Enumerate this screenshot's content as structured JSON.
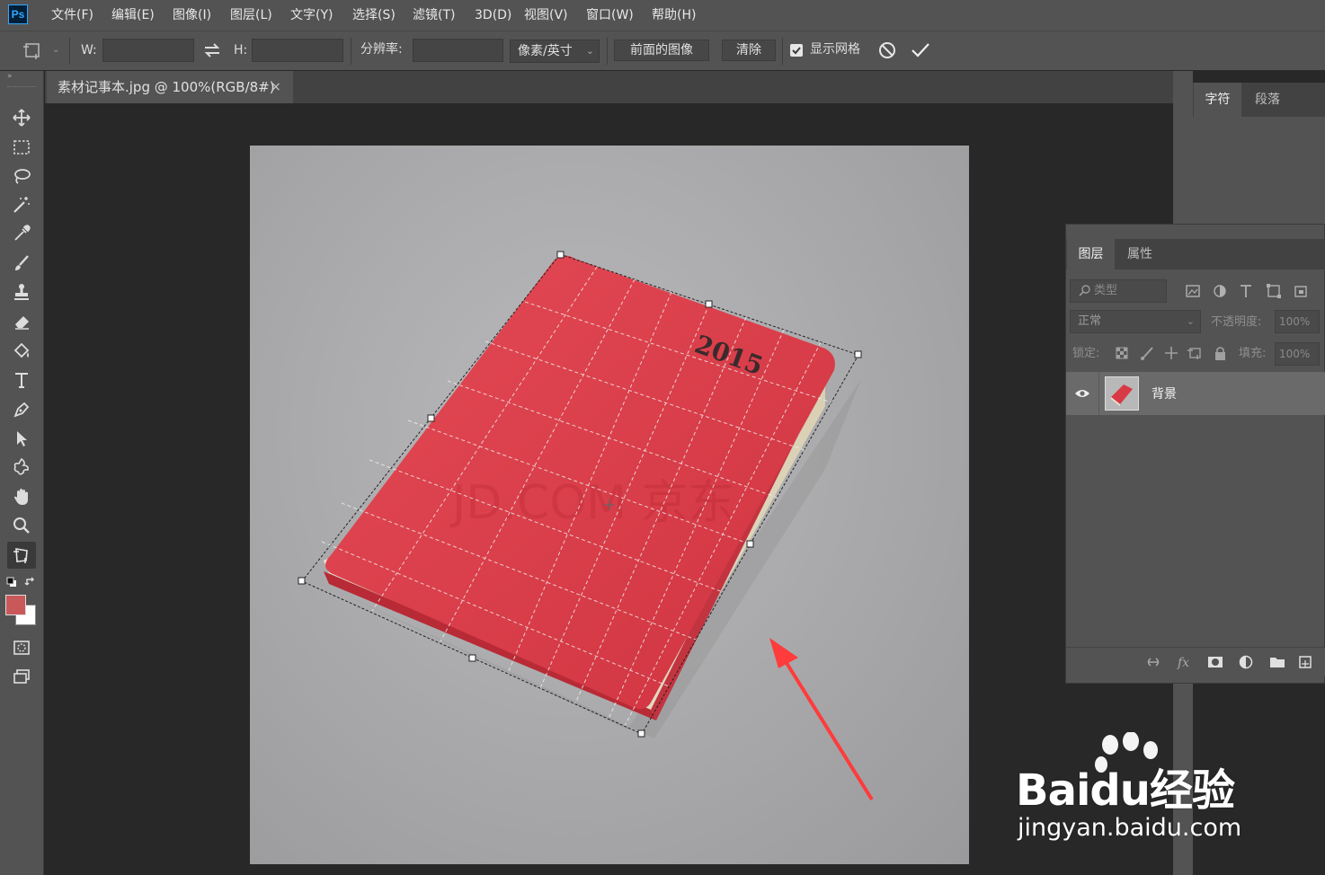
{
  "app": {
    "logo": "Ps"
  },
  "menu": [
    "文件(F)",
    "编辑(E)",
    "图像(I)",
    "图层(L)",
    "文字(Y)",
    "选择(S)",
    "滤镜(T)",
    "3D(D)",
    "视图(V)",
    "窗口(W)",
    "帮助(H)"
  ],
  "options": {
    "w_label": "W:",
    "w_value": "",
    "h_label": "H:",
    "h_value": "",
    "resolution_label": "分辨率:",
    "resolution_value": "",
    "units": "像素/英寸",
    "front_image": "前面的图像",
    "clear": "清除",
    "show_grid_label": "显示网格",
    "show_grid_checked": true
  },
  "document": {
    "tab_title": "素材记事本.jpg @ 100%(RGB/8#)",
    "close_glyph": "×",
    "book_year": "2015",
    "faint_watermark": "JD.COM 京东"
  },
  "char_panel": {
    "tabs": [
      "字符",
      "段落"
    ]
  },
  "layers_panel": {
    "tabs": [
      "图层",
      "属性"
    ],
    "filter_placeholder": "类型",
    "blend_mode": "正常",
    "opacity_label": "不透明度:",
    "opacity_value": "100%",
    "lock_label": "锁定:",
    "fill_label": "填充:",
    "fill_value": "100%",
    "layers": [
      {
        "name": "背景",
        "visible": true
      }
    ]
  },
  "watermark": {
    "brand": "Baidu经验",
    "url": "jingyan.baidu.com"
  },
  "colors": {
    "accent": "#31a8ff",
    "book_red": "#d83a45",
    "foreground": "#c8585a",
    "arrow": "#ff3b3b"
  }
}
